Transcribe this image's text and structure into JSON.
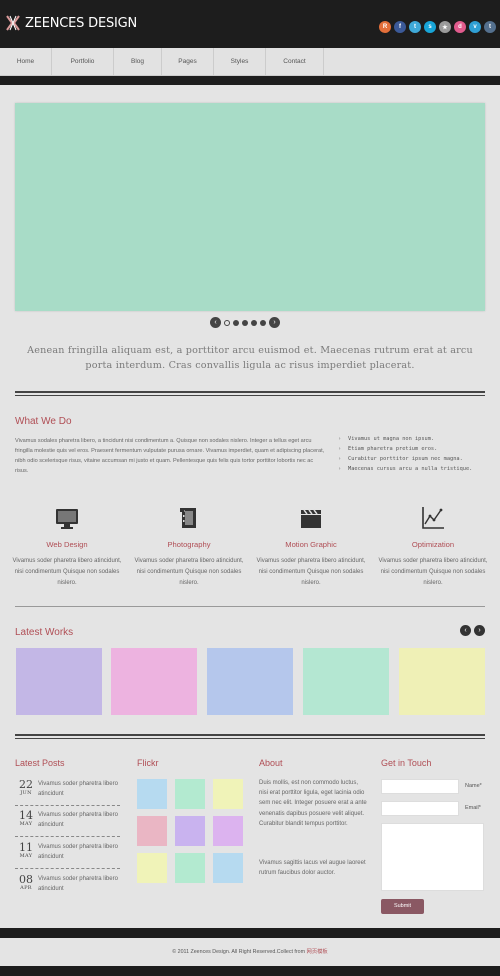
{
  "header": {
    "logo_text": "ZEENCES DESIGN",
    "social": [
      {
        "icon": "rss-icon",
        "glyph": "R",
        "color": "#e36f3a"
      },
      {
        "icon": "facebook-icon",
        "glyph": "f",
        "color": "#3b5998"
      },
      {
        "icon": "twitter-icon",
        "glyph": "t",
        "color": "#3fa9d8"
      },
      {
        "icon": "skype-icon",
        "glyph": "s",
        "color": "#18a5d8"
      },
      {
        "icon": "star-icon",
        "glyph": "★",
        "color": "#9b9b9b"
      },
      {
        "icon": "dribbble-icon",
        "glyph": "d",
        "color": "#e15b8d"
      },
      {
        "icon": "vimeo-icon",
        "glyph": "v",
        "color": "#2f9fd4"
      },
      {
        "icon": "tumblr-icon",
        "glyph": "t",
        "color": "#54708e"
      }
    ]
  },
  "nav": {
    "items": [
      "Home",
      "Portfolio",
      "Blog",
      "Pages",
      "Styles",
      "Contact"
    ]
  },
  "slider": {
    "slide_color": "#a8dcc7",
    "prev": "‹",
    "next": "›"
  },
  "intro": "Aenean fringilla aliquam est, a porttitor arcu euismod et. Maecenas rutrum erat at arcu porta interdum. Cras convallis ligula ac risus imperdiet placerat.",
  "what_we_do": {
    "title": "What We Do",
    "text": "Vivamus sodales pharetra libero, a tincidunt nisi condimentum a. Quisque non sodales nislero. Integer a tellus eget arcu fringilla molestie quis vel eros. Praesent fermentum vulputate purusa ornare. Vivamus imperdiet, quam et adipiscing placerat, nibh odio scelerisque risus, vitaine accumsan mi justo et quam. Pellentesque quis felis quis tortor porttitor lobortis nec ac risus.",
    "list": [
      "Vivamus ut magna non ipsum.",
      "Etiam pharetra pretium eros.",
      "Curabitur porttitor ipsum nec magna.",
      "Maecenas cursus arcu a nulla tristique."
    ]
  },
  "services": [
    {
      "name": "Web Design",
      "icon": "monitor-icon",
      "desc": "Vivamus soder pharetra libero atincidunt, nisi condimentum Quisque non sodales nislero."
    },
    {
      "name": "Photography",
      "icon": "film-icon",
      "desc": "Vivamus soder pharetra libero atincidunt, nisi condimentum Quisque non sodales nislero."
    },
    {
      "name": "Motion Graphic",
      "icon": "clapperboard-icon",
      "desc": "Vivamus soder pharetra libero atincidunt, nisi condimentum Quisque non sodales nislero."
    },
    {
      "name": "Optimization",
      "icon": "chart-icon",
      "desc": "Vivamus soder pharetra libero atincidunt, nisi condimentum Quisque non sodales nislero."
    }
  ],
  "latest_works": {
    "title": "Latest Works",
    "prev": "‹",
    "next": "›",
    "colors": [
      "#c3b7e6",
      "#edb3e0",
      "#b5c7ec",
      "#b4e7d2",
      "#eff0b6"
    ]
  },
  "latest_posts": {
    "title": "Latest Posts",
    "posts": [
      {
        "day": "22",
        "month": "JUN",
        "text": "Vivamus soder pharetra libero atincidunt"
      },
      {
        "day": "14",
        "month": "MAY",
        "text": "Vivamus soder pharetra libero atincidunt"
      },
      {
        "day": "11",
        "month": "MAY",
        "text": "Vivamus soder pharetra libero atincidunt"
      },
      {
        "day": "08",
        "month": "APR",
        "text": "Vivamus soder pharetra libero atincidunt"
      }
    ]
  },
  "flickr": {
    "title": "Flickr",
    "colors": [
      "#b6daf0",
      "#b3ead0",
      "#f0f3b8",
      "#eab6c4",
      "#c9b3ef",
      "#dcb3ef",
      "#f0f3b8",
      "#b3ead0",
      "#b6daf0"
    ]
  },
  "about": {
    "title": "About",
    "para1": "Duis mollis, est non commodo luctus, nisi erat porttitor ligula, eget lacinia odio sem nec elit. Integer posuere erat a ante venenatis dapibus posuere velit aliquet. Curabitur blandit tempus porttitor.",
    "para2": "Vivamus sagittis lacus vel augue laoreet rutrum faucibus dolor auctor."
  },
  "contact": {
    "title": "Get in Touch",
    "name_label": "Name*",
    "email_label": "Email*",
    "submit": "Submit"
  },
  "footer": {
    "text": "© 2011 Zeences Design. All Right Reserved.Collect from",
    "link": "网页模板"
  }
}
